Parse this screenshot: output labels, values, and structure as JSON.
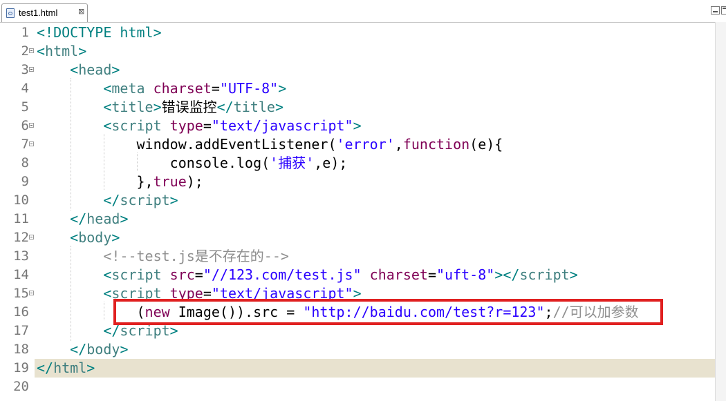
{
  "tab": {
    "filename": "test1.html",
    "close_label": "⊠"
  },
  "lines": [
    {
      "n": "1",
      "fold": false,
      "parts": [
        [
          "br",
          "<!DOCTYPE html>"
        ]
      ]
    },
    {
      "n": "2",
      "fold": true,
      "parts": [
        [
          "br",
          "<"
        ],
        [
          "tag",
          "html"
        ],
        [
          "br",
          ">"
        ]
      ]
    },
    {
      "n": "3",
      "fold": true,
      "parts": [
        [
          "sp",
          "    "
        ],
        [
          "br",
          "<"
        ],
        [
          "tag",
          "head"
        ],
        [
          "br",
          ">"
        ]
      ]
    },
    {
      "n": "4",
      "fold": false,
      "parts": [
        [
          "sp",
          "        "
        ],
        [
          "br",
          "<"
        ],
        [
          "tag",
          "meta"
        ],
        [
          "sp",
          " "
        ],
        [
          "attr",
          "charset"
        ],
        [
          "id",
          "="
        ],
        [
          "str",
          "\"UTF-8\""
        ],
        [
          "br",
          ">"
        ]
      ]
    },
    {
      "n": "5",
      "fold": false,
      "parts": [
        [
          "sp",
          "        "
        ],
        [
          "br",
          "<"
        ],
        [
          "tag",
          "title"
        ],
        [
          "br",
          ">"
        ],
        [
          "id",
          "错误监控"
        ],
        [
          "br",
          "</"
        ],
        [
          "tag",
          "title"
        ],
        [
          "br",
          ">"
        ]
      ]
    },
    {
      "n": "6",
      "fold": true,
      "parts": [
        [
          "sp",
          "        "
        ],
        [
          "br",
          "<"
        ],
        [
          "tag",
          "script"
        ],
        [
          "sp",
          " "
        ],
        [
          "attr",
          "type"
        ],
        [
          "id",
          "="
        ],
        [
          "str",
          "\"text/javascript\""
        ],
        [
          "br",
          ">"
        ]
      ]
    },
    {
      "n": "7",
      "fold": true,
      "parts": [
        [
          "sp",
          "            "
        ],
        [
          "fn",
          "window.addEventListener("
        ],
        [
          "str",
          "'error'"
        ],
        [
          "id",
          ","
        ],
        [
          "kw",
          "function"
        ],
        [
          "id",
          "(e){"
        ]
      ]
    },
    {
      "n": "8",
      "fold": false,
      "parts": [
        [
          "sp",
          "                "
        ],
        [
          "fn",
          "console.log("
        ],
        [
          "str",
          "'捕获'"
        ],
        [
          "id",
          ",e);"
        ]
      ]
    },
    {
      "n": "9",
      "fold": false,
      "parts": [
        [
          "sp",
          "            "
        ],
        [
          "id",
          "},"
        ],
        [
          "kw",
          "true"
        ],
        [
          "id",
          ");"
        ]
      ]
    },
    {
      "n": "10",
      "fold": false,
      "parts": [
        [
          "sp",
          "        "
        ],
        [
          "br",
          "</"
        ],
        [
          "tag",
          "script"
        ],
        [
          "br",
          ">"
        ]
      ]
    },
    {
      "n": "11",
      "fold": false,
      "parts": [
        [
          "sp",
          "    "
        ],
        [
          "br",
          "</"
        ],
        [
          "tag",
          "head"
        ],
        [
          "br",
          ">"
        ]
      ]
    },
    {
      "n": "12",
      "fold": true,
      "parts": [
        [
          "sp",
          "    "
        ],
        [
          "br",
          "<"
        ],
        [
          "tag",
          "body"
        ],
        [
          "br",
          ">"
        ]
      ]
    },
    {
      "n": "13",
      "fold": false,
      "parts": [
        [
          "sp",
          "        "
        ],
        [
          "cmt",
          "<!--test.js是不存在的-->"
        ]
      ]
    },
    {
      "n": "14",
      "fold": false,
      "parts": [
        [
          "sp",
          "        "
        ],
        [
          "br",
          "<"
        ],
        [
          "tag",
          "script"
        ],
        [
          "sp",
          " "
        ],
        [
          "attr",
          "src"
        ],
        [
          "id",
          "="
        ],
        [
          "str",
          "\"//123.com/test.js\""
        ],
        [
          "sp",
          " "
        ],
        [
          "attr",
          "charset"
        ],
        [
          "id",
          "="
        ],
        [
          "str",
          "\"uft-8\""
        ],
        [
          "br",
          "></"
        ],
        [
          "tag",
          "script"
        ],
        [
          "br",
          ">"
        ]
      ]
    },
    {
      "n": "15",
      "fold": true,
      "parts": [
        [
          "sp",
          "        "
        ],
        [
          "br",
          "<"
        ],
        [
          "tag",
          "script"
        ],
        [
          "sp",
          " "
        ],
        [
          "attr",
          "type"
        ],
        [
          "id",
          "="
        ],
        [
          "str",
          "\"text/javascript\""
        ],
        [
          "br",
          ">"
        ]
      ]
    },
    {
      "n": "16",
      "fold": false,
      "parts": [
        [
          "sp",
          "            "
        ],
        [
          "id",
          "("
        ],
        [
          "kw",
          "new"
        ],
        [
          "id",
          " Image()).src = "
        ],
        [
          "str",
          "\"http://baidu.com/test?r=123\""
        ],
        [
          "id",
          ";"
        ],
        [
          "cmt",
          "//可以加参数"
        ]
      ]
    },
    {
      "n": "17",
      "fold": false,
      "parts": [
        [
          "sp",
          "        "
        ],
        [
          "br",
          "</"
        ],
        [
          "tag",
          "script"
        ],
        [
          "br",
          ">"
        ]
      ]
    },
    {
      "n": "18",
      "fold": false,
      "parts": [
        [
          "sp",
          "    "
        ],
        [
          "br",
          "</"
        ],
        [
          "tag",
          "body"
        ],
        [
          "br",
          ">"
        ]
      ]
    },
    {
      "n": "19",
      "fold": false,
      "current": true,
      "parts": [
        [
          "br",
          "</"
        ],
        [
          "tag",
          "html"
        ],
        [
          "br",
          ">"
        ]
      ]
    },
    {
      "n": "20",
      "fold": false,
      "parts": []
    }
  ],
  "colors": {
    "tag": "#3f7f7f",
    "attr": "#7f0055",
    "string": "#2a00ff",
    "comment": "#8f8f8f",
    "keyword": "#7f0055",
    "current_line": "#e8e2cf",
    "highlight_box": "#e02020"
  },
  "icons": {
    "file": "html-file-icon",
    "close": "close-tab-icon",
    "minimize": "minimize-icon",
    "maximize": "maximize-icon",
    "fold": "fold-collapse-icon"
  }
}
